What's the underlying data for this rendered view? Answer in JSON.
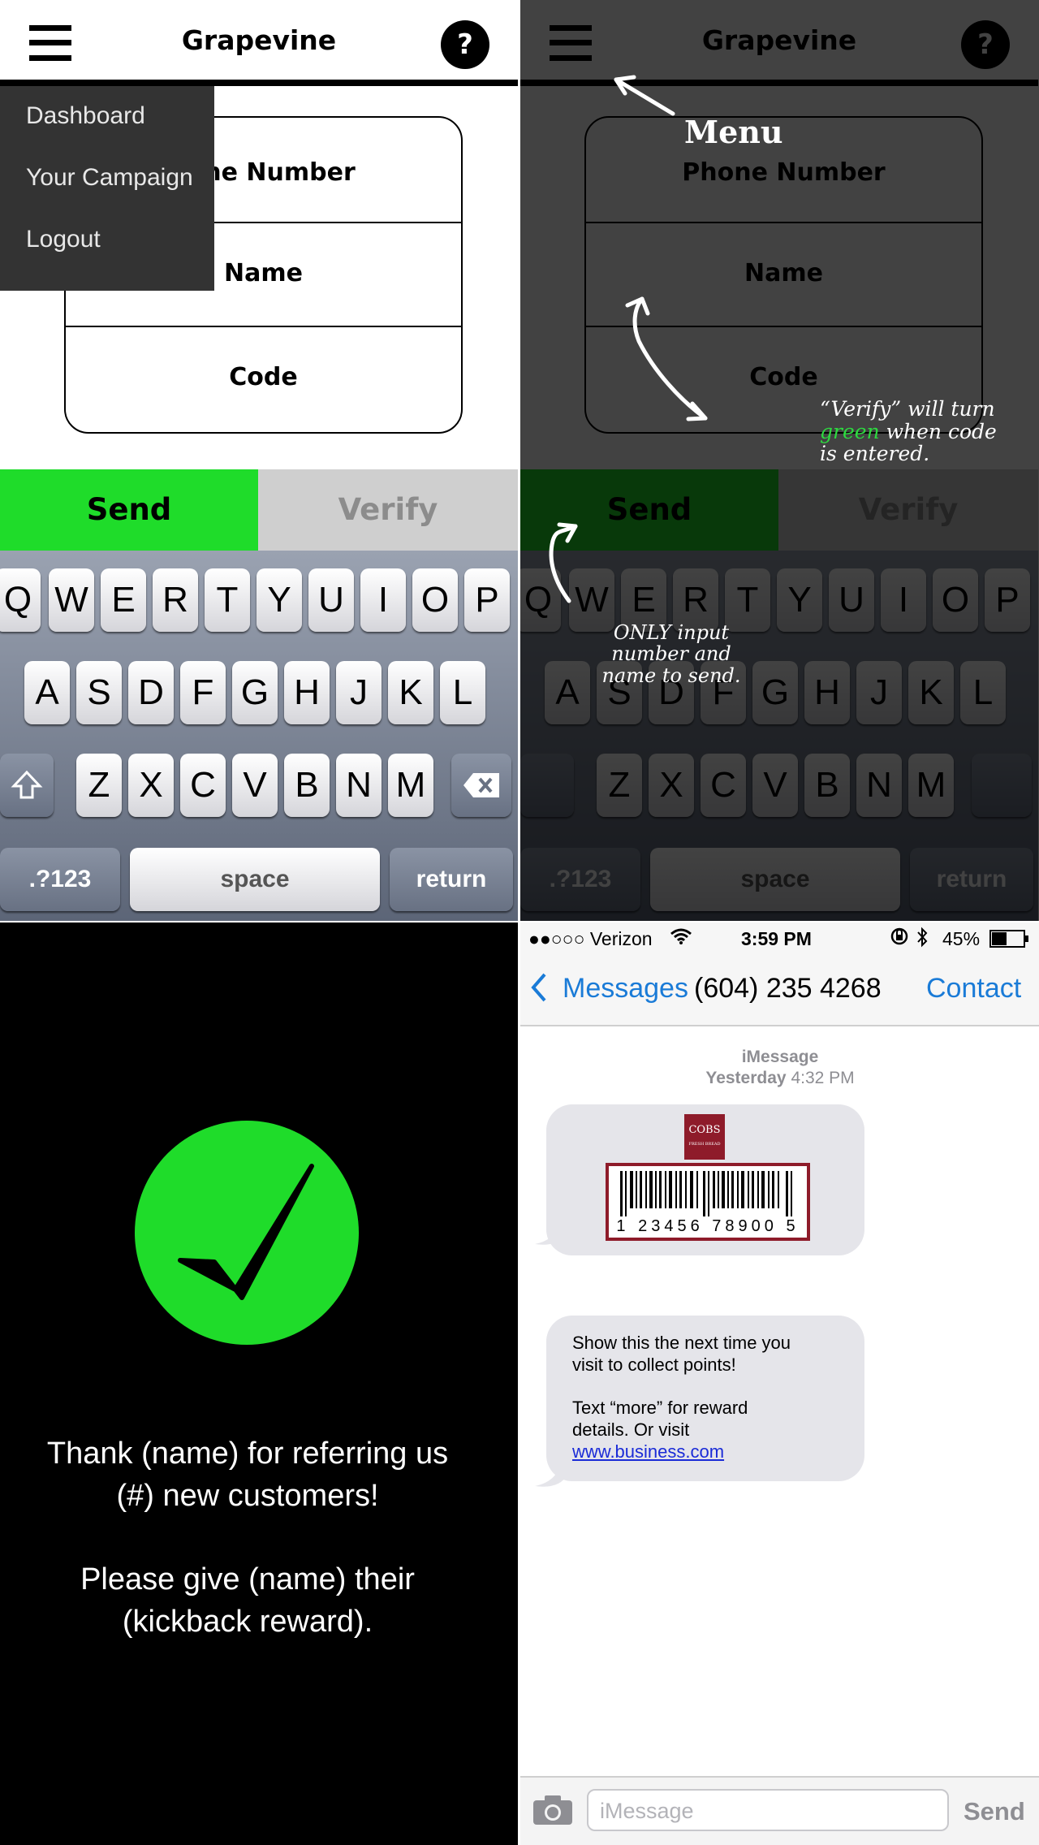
{
  "app": {
    "title": "Grapevine",
    "help_label": "?",
    "menu": [
      "Dashboard",
      "Your Campaign",
      "Logout"
    ],
    "fields": {
      "phone": "Phone Number",
      "phone_partial": "ne Number",
      "name": "Name",
      "code": "Code"
    },
    "send_label": "Send",
    "verify_label": "Verify",
    "keyboard": {
      "row1": [
        "Q",
        "W",
        "E",
        "R",
        "T",
        "Y",
        "U",
        "I",
        "O",
        "P"
      ],
      "row2": [
        "A",
        "S",
        "D",
        "F",
        "G",
        "H",
        "J",
        "K",
        "L"
      ],
      "row3": [
        "Z",
        "X",
        "C",
        "V",
        "B",
        "N",
        "M"
      ],
      "numbers": ".?123",
      "space": "space",
      "return": "return"
    },
    "colors": {
      "send": "#1fdc2a",
      "verify": "#cfcfcf"
    }
  },
  "annotations": {
    "menu": "Menu",
    "verify_note_1": "“Verify” will turn",
    "verify_note_green": "green",
    "verify_note_2": " when code",
    "verify_note_3": "is entered.",
    "send_note": [
      "ONLY input",
      "number and",
      "name to send."
    ]
  },
  "success": {
    "line1": "Thank (name) for referring us",
    "line2": "(#) new customers!",
    "line3": "Please give (name) their",
    "line4": "(kickback reward)."
  },
  "imessage": {
    "status": {
      "carrier": "●●○○○ Verizon",
      "time": "3:59 PM",
      "battery": "45%"
    },
    "back_label": "Messages",
    "contact_number": "(604) 235 4268",
    "contact_button": "Contact",
    "service": "iMessage",
    "day": "Yesterday",
    "time": "4:32 PM",
    "logo_text": "COBS",
    "logo_sub": "FRESH BREAD",
    "barcode_number": "1 23456 78900 5",
    "message_line1": "Show this the next time you",
    "message_line2": "visit to collect points!",
    "message_line3": "Text “more” for reward",
    "message_line4": "details. Or visit",
    "message_link": "www.business.com",
    "input_placeholder": "iMessage",
    "send_label": "Send"
  }
}
